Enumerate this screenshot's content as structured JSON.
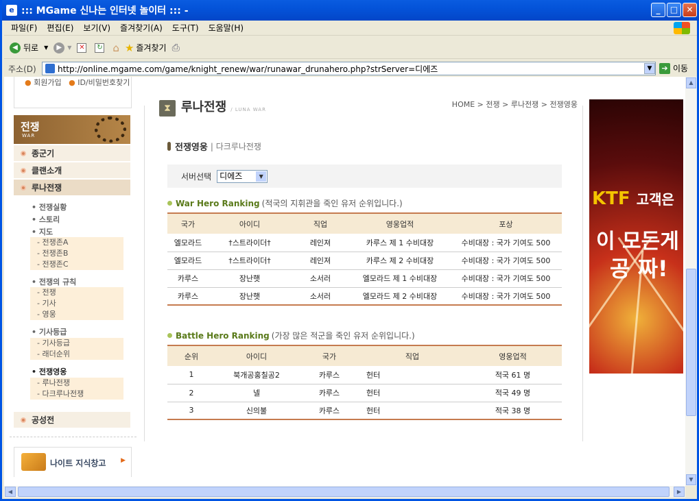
{
  "window": {
    "title": "::: MGame 신나는 인터넷 놀이터 ::: -"
  },
  "menu": [
    "파일(F)",
    "편집(E)",
    "보기(V)",
    "즐겨찾기(A)",
    "도구(T)",
    "도움말(H)"
  ],
  "toolbar": {
    "back": "뒤로",
    "favorites": "즐겨찾기"
  },
  "address": {
    "label": "주소(D)",
    "url": "http://online.mgame.com/game/knight_renew/war/runawar_drunahero.php?strServer=디에즈",
    "go": "이동"
  },
  "top_links": [
    "회원가입",
    "ID/비밀번호찾기"
  ],
  "nav": {
    "head": "전쟁",
    "head_en": "WAR",
    "items": [
      "종군기",
      "클랜소개",
      "루나전쟁"
    ],
    "sub": {
      "status": "전쟁실황",
      "story": "스토리",
      "map": "지도",
      "map_items": [
        "- 전쟁존A",
        "- 전쟁존B",
        "- 전쟁존C"
      ],
      "rules": "전쟁의 규칙",
      "rules_items": [
        "- 전쟁",
        "- 기사",
        "- 영웅"
      ],
      "knight": "기사등급",
      "knight_items": [
        "- 기사등급",
        "- 래더순위"
      ],
      "hero": "전쟁영웅",
      "hero_items": [
        "- 루나전쟁",
        "- 다크루나전쟁"
      ]
    },
    "last": "공성전",
    "knowledge": "나이트 지식창고"
  },
  "main": {
    "title": "루나전쟁",
    "title_en": "/ LUNA WAR",
    "breadcrumb": "HOME > 전쟁 > 루나전쟁 > 전쟁영웅",
    "section": "전쟁영웅",
    "section_sub": "| 다크루나전쟁",
    "server_label": "서버선택",
    "server_value": "디에즈",
    "war_hero": {
      "title_en": "War Hero Ranking",
      "title_ko": "(적국의 지휘관을 죽인 유저 순위입니다.)",
      "headers": [
        "국가",
        "아이디",
        "직업",
        "영웅업적",
        "포상"
      ],
      "rows": [
        [
          "엘모라드",
          "†스트라이더†",
          "레인져",
          "카루스 제 1 수비대장",
          "수비대장 : 국가 기여도 500"
        ],
        [
          "엘모라드",
          "†스트라이더†",
          "레인져",
          "카루스 제 2 수비대장",
          "수비대장 : 국가 기여도 500"
        ],
        [
          "카루스",
          "장난햇",
          "소서러",
          "엘모라드 제 1 수비대장",
          "수비대장 : 국가 기여도 500"
        ],
        [
          "카루스",
          "장난햇",
          "소서러",
          "엘모라드 제 2 수비대장",
          "수비대장 : 국가 기여도 500"
        ]
      ]
    },
    "battle_hero": {
      "title_en": "Battle Hero Ranking",
      "title_ko": "(가장 많은 적군을 죽인 유저 순위입니다.)",
      "headers": [
        "순위",
        "아이디",
        "국가",
        "직업",
        "영웅업적"
      ],
      "rows": [
        [
          "1",
          "북개공홍칠공2",
          "카루스",
          "헌터",
          "적국 61 명"
        ],
        [
          "2",
          "넬",
          "카루스",
          "헌터",
          "적국 49 명"
        ],
        [
          "3",
          "신의불",
          "카루스",
          "헌터",
          "적국 38 명"
        ]
      ]
    }
  },
  "ad": {
    "line1a": "KTF",
    "line1b": "고객은",
    "line2": "이 모든게",
    "line3": "공 짜!"
  }
}
